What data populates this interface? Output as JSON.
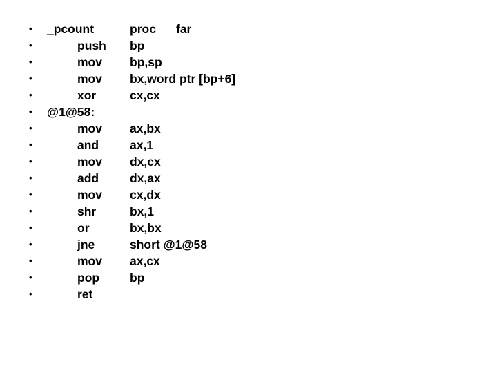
{
  "slide": {
    "background_color": "#ffffff",
    "text_color": "#000000",
    "bullet_glyph": "•",
    "lines": [
      {
        "bullet": "•",
        "label": "_pcount",
        "mnemonic": "",
        "operands": "proc",
        "operand_extra": "far"
      },
      {
        "bullet": "•",
        "label": "",
        "mnemonic": "push",
        "operands": "bp",
        "operand_extra": ""
      },
      {
        "bullet": "•",
        "label": "",
        "mnemonic": "mov",
        "operands": "bp,sp",
        "operand_extra": ""
      },
      {
        "bullet": "•",
        "label": "",
        "mnemonic": "mov",
        "operands": "bx,word ptr [bp+6]",
        "operand_extra": ""
      },
      {
        "bullet": "•",
        "label": "",
        "mnemonic": "xor",
        "operands": "cx,cx",
        "operand_extra": ""
      },
      {
        "bullet": "•",
        "label": "@1@58:",
        "mnemonic": "",
        "operands": "",
        "operand_extra": ""
      },
      {
        "bullet": "•",
        "label": "",
        "mnemonic": "mov",
        "operands": "ax,bx",
        "operand_extra": ""
      },
      {
        "bullet": "•",
        "label": "",
        "mnemonic": "and",
        "operands": "ax,1",
        "operand_extra": ""
      },
      {
        "bullet": "•",
        "label": "",
        "mnemonic": "mov",
        "operands": "dx,cx",
        "operand_extra": ""
      },
      {
        "bullet": "•",
        "label": "",
        "mnemonic": "add",
        "operands": "dx,ax",
        "operand_extra": ""
      },
      {
        "bullet": "•",
        "label": "",
        "mnemonic": "mov",
        "operands": "cx,dx",
        "operand_extra": ""
      },
      {
        "bullet": "•",
        "label": "",
        "mnemonic": "shr",
        "operands": "bx,1",
        "operand_extra": ""
      },
      {
        "bullet": "•",
        "label": "",
        "mnemonic": "or",
        "operands": "bx,bx",
        "operand_extra": ""
      },
      {
        "bullet": "•",
        "label": "",
        "mnemonic": "jne",
        "operands": "short @1@58",
        "operand_extra": ""
      },
      {
        "bullet": "•",
        "label": "",
        "mnemonic": "mov",
        "operands": "ax,cx",
        "operand_extra": ""
      },
      {
        "bullet": "•",
        "label": "",
        "mnemonic": "pop",
        "operands": "bp",
        "operand_extra": ""
      },
      {
        "bullet": "•",
        "label": "",
        "mnemonic": "ret",
        "operands": "",
        "operand_extra": ""
      }
    ]
  }
}
